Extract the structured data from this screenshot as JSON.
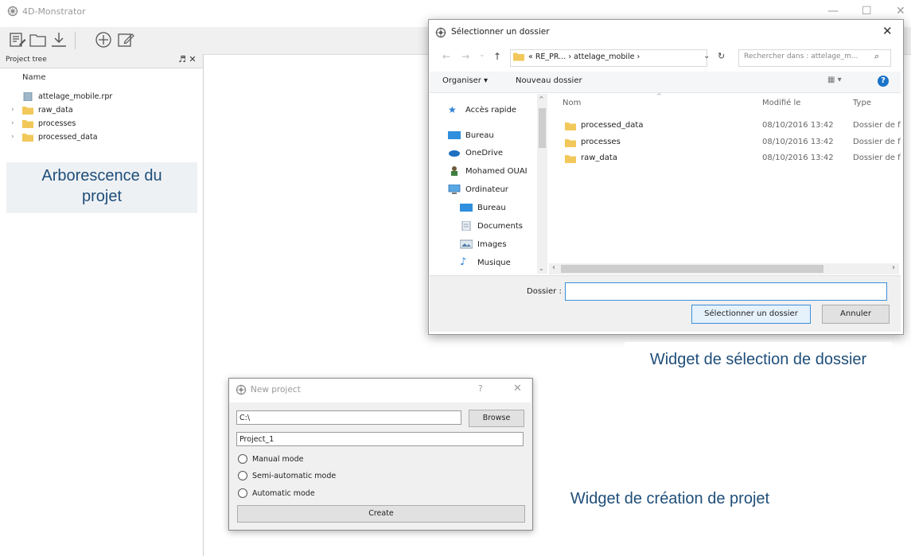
{
  "app": {
    "title": "4D-Monstrator",
    "controls": {
      "minimize": "—",
      "maximize": "☐",
      "close": "✕"
    }
  },
  "toolbar": {
    "buttons": [
      "edit-icon",
      "folder-open-icon",
      "download-icon",
      "add-circle-icon",
      "edit-note-icon"
    ]
  },
  "project_tree": {
    "title": "Project tree",
    "actions": "♬ ✕",
    "column": "Name",
    "items": [
      {
        "label": "attelage_mobile.rpr",
        "icon": "file-icon",
        "expandable": false
      },
      {
        "label": "raw_data",
        "icon": "folder-icon",
        "expandable": true
      },
      {
        "label": "processes",
        "icon": "folder-icon",
        "expandable": true
      },
      {
        "label": "processed_data",
        "icon": "folder-icon",
        "expandable": true
      }
    ]
  },
  "captions": {
    "tree": [
      "Arborescence du",
      "projet"
    ],
    "folder": "Widget de sélection de dossier",
    "project": "Widget de création de projet"
  },
  "folder_dialog": {
    "title": "Sélectionner un dossier",
    "close": "✕",
    "path": "« RE_PR...  ›  attelage_mobile  ›",
    "search_placeholder": "Rechercher dans : attelage_m...",
    "organize": "Organiser ▾",
    "new_folder": "Nouveau dossier",
    "help": "?",
    "nav": [
      {
        "label": "Accès rapide",
        "icon": "star-icon",
        "sub": false
      },
      {
        "label": "Bureau",
        "icon": "desktop-icon",
        "sub": false
      },
      {
        "label": "OneDrive",
        "icon": "cloud-icon",
        "sub": false
      },
      {
        "label": "Mohamed OUAI",
        "icon": "user-icon",
        "sub": false
      },
      {
        "label": "Ordinateur",
        "icon": "computer-icon",
        "sub": false
      },
      {
        "label": "Bureau",
        "icon": "desktop-icon",
        "sub": true
      },
      {
        "label": "Documents",
        "icon": "document-icon",
        "sub": true
      },
      {
        "label": "Images",
        "icon": "image-icon",
        "sub": true
      },
      {
        "label": "Musique",
        "icon": "music-icon",
        "sub": true
      }
    ],
    "columns": {
      "name": "Nom",
      "modified": "Modifié le",
      "type": "Type"
    },
    "files": [
      {
        "name": "processed_data",
        "modified": "08/10/2016 13:42",
        "type": "Dossier de f"
      },
      {
        "name": "processes",
        "modified": "08/10/2016 13:42",
        "type": "Dossier de f"
      },
      {
        "name": "raw_data",
        "modified": "08/10/2016 13:42",
        "type": "Dossier de f"
      }
    ],
    "folder_label": "Dossier :",
    "folder_value": "",
    "select_label": "Sélectionner un dossier",
    "cancel_label": "Annuler"
  },
  "new_project": {
    "title": "New project",
    "help": "?",
    "close": "✕",
    "path": "C:\\",
    "browse_label": "Browse",
    "name": "Project_1",
    "modes": [
      "Manual mode",
      "Semi-automatic mode",
      "Automatic mode"
    ],
    "create_label": "Create"
  },
  "colors": {
    "caption_text": "#1f4e79",
    "folder": "#f2c85b",
    "accent": "#3c8fd8"
  }
}
